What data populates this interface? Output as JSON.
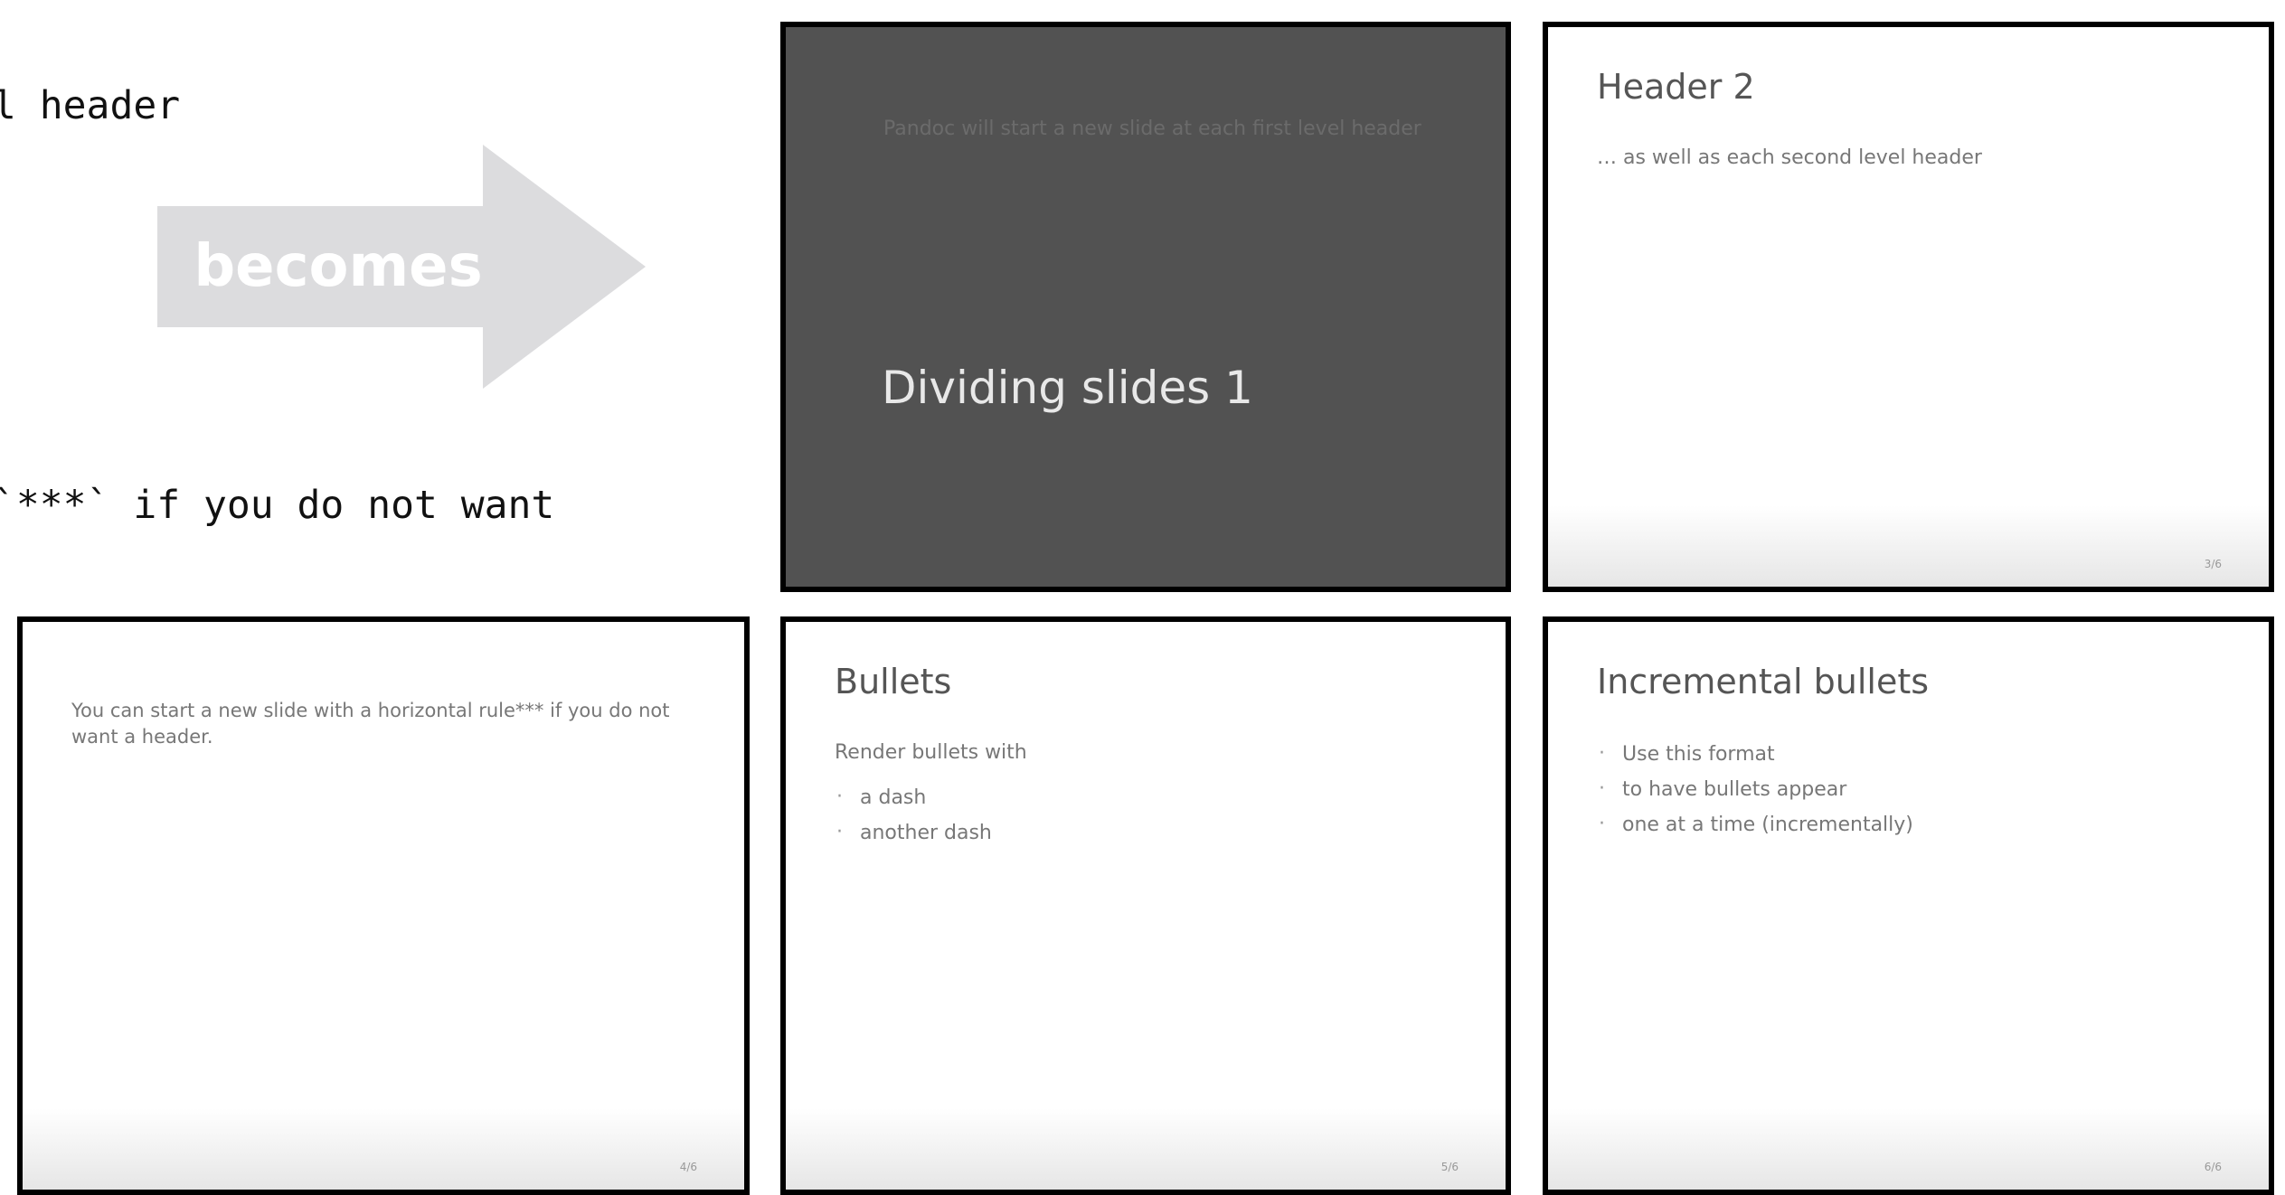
{
  "code_panel": {
    "line_1": "l header",
    "line_2": "`***` if you do not want"
  },
  "arrow": {
    "label": "becomes",
    "color": "#dcdcde"
  },
  "slides": [
    {
      "subtitle": "Pandoc will start a new slide at each first level header",
      "title": "Dividing slides 1",
      "background": "#525252"
    },
    {
      "title": "Header 2",
      "text": "… as well as each second level header",
      "page": "3/6"
    },
    {
      "text": "You can start a new slide with a horizontal rule*** if you do not want a header.",
      "page": "4/6"
    },
    {
      "title": "Bullets",
      "text": "Render bullets with",
      "items": [
        "a dash",
        "another dash"
      ],
      "page": "5/6"
    },
    {
      "title": "Incremental bullets",
      "items": [
        "Use this format",
        "to have bullets appear",
        "one at a time (incrementally)"
      ],
      "page": "6/6"
    }
  ]
}
